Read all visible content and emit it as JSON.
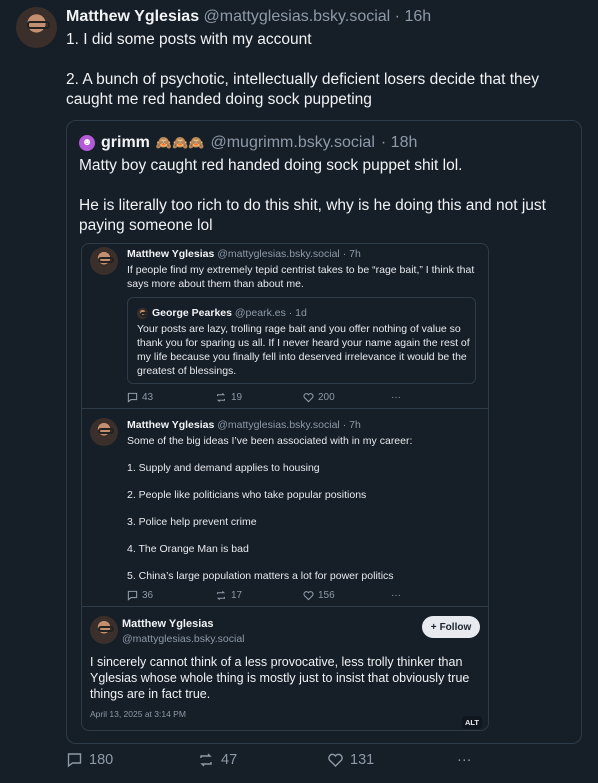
{
  "post": {
    "author_name": "Matthew Yglesias",
    "author_handle": "@mattyglesias.bsky.social",
    "time": "· 16h",
    "text": [
      "1. I did some posts with my account",
      "2. A bunch of psychotic, intellectually deficient losers decide that they caught me red handed doing sock puppeting"
    ],
    "stats": {
      "replies": "180",
      "reposts": "47",
      "likes": "131"
    }
  },
  "quote": {
    "author_name": "grimm",
    "author_emoji": "🙈🙈🙈",
    "author_handle": "@mugrimm.bsky.social",
    "time": "· 18h",
    "text": [
      "Matty boy caught red handed doing sock puppet shit lol.",
      "He is literally too rich to do this shit, why is he doing this and not just paying someone lol"
    ]
  },
  "screenshot": {
    "post1": {
      "author_name": "Matthew Yglesias",
      "author_handle": "@mattyglesias.bsky.social",
      "time": "· 7h",
      "text": "If people find my extremely tepid centrist takes to be “rage bait,” I think that says more about them than about me.",
      "quoted": {
        "author_name": "George Pearkes",
        "author_handle": "@peark.es",
        "time": "· 1d",
        "text": "Your posts are lazy, trolling rage bait and you offer nothing of value so thank you for sparing us all. If I never heard your name again the rest of my life because you finally fell into deserved irrelevance it would be the greatest of blessings."
      },
      "stats": {
        "replies": "43",
        "reposts": "19",
        "likes": "200"
      }
    },
    "post2": {
      "author_name": "Matthew Yglesias",
      "author_handle": "@mattyglesias.bsky.social",
      "time": "· 7h",
      "intro": "Some of the big ideas I’ve been associated with in my career:",
      "items": [
        "1. Supply and demand applies to housing",
        "2. People like politicians who take popular positions",
        "3. Police help prevent crime",
        "4. The Orange Man is bad",
        "5. China’s large population matters a lot for power politics"
      ],
      "stats": {
        "replies": "36",
        "reposts": "17",
        "likes": "156"
      }
    },
    "post3": {
      "author_name": "Matthew Yglesias",
      "author_handle": "@mattyglesias.bsky.social",
      "follow_label": "Follow",
      "text": "I sincerely cannot think of a less provocative, less trolly thinker than Yglesias whose whole thing is mostly just to insist that obviously true things are in fact true.",
      "date": "April 13, 2025 at 3:14 PM",
      "alt_label": "ALT"
    }
  },
  "more_label": "···",
  "colors": {
    "background": "#161e27",
    "text": "#f1f3f5",
    "muted": "#8d9aa9",
    "border": "#2e3b49"
  }
}
